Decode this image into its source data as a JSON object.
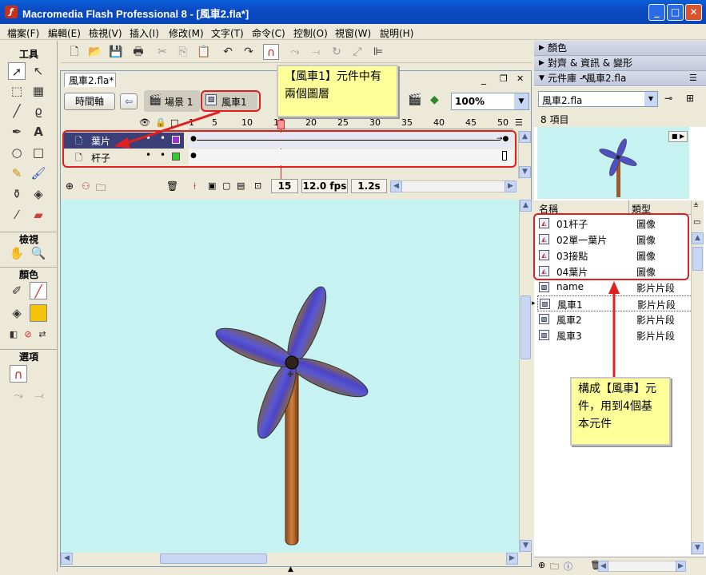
{
  "window": {
    "title": "Macromedia Flash Professional 8 - [風車2.fla*]",
    "min": "_",
    "max": "□",
    "close": "✕"
  },
  "menu": [
    "檔案(F)",
    "編輯(E)",
    "檢視(V)",
    "插入(I)",
    "修改(M)",
    "文字(T)",
    "命令(C)",
    "控制(O)",
    "視窗(W)",
    "說明(H)"
  ],
  "tools": {
    "header": "工具",
    "view_header": "檢視",
    "color_header": "顏色",
    "options_header": "選項"
  },
  "document": {
    "tab": "風車2.fla*",
    "timeline_button": "時間軸",
    "breadcrumb_scene": "場景 1",
    "breadcrumb_symbol": "風車1",
    "zoom": "100%"
  },
  "timeline": {
    "frame_numbers": [
      "1",
      "5",
      "10",
      "15",
      "20",
      "25",
      "30",
      "35",
      "40",
      "45",
      "50"
    ],
    "layers": [
      {
        "name": "葉片",
        "color": "#9933cc"
      },
      {
        "name": "杆子",
        "color": "#33cc33"
      }
    ],
    "current_frame": "15",
    "fps": "12.0 fps",
    "time": "1.2s"
  },
  "library": {
    "panel_color": "顏色",
    "panel_align": "對齊 & 資訊 & 變形",
    "panel_library": "元件庫 - 風車2.fla",
    "file_select": "風車2.fla",
    "count": "8 項目",
    "col_name": "名稱",
    "col_type": "類型",
    "items": [
      {
        "name": "01杆子",
        "type": "圖像"
      },
      {
        "name": "02單一葉片",
        "type": "圖像"
      },
      {
        "name": "03接點",
        "type": "圖像"
      },
      {
        "name": "04葉片",
        "type": "圖像"
      },
      {
        "name": "name",
        "type": "影片片段"
      },
      {
        "name": "風車1",
        "type": "影片片段"
      },
      {
        "name": "風車2",
        "type": "影片片段"
      },
      {
        "name": "風車3",
        "type": "影片片段"
      }
    ]
  },
  "callouts": {
    "top_line1": "【風車1】元件中有",
    "top_line2": "兩個圖層",
    "bottom_line1": "構成【風車】元",
    "bottom_line2": "件，用到4個基",
    "bottom_line3": "本元件"
  },
  "colors": {
    "stage": "#c6f2f2",
    "highlight": "#e02020",
    "callout": "#ffff99"
  }
}
